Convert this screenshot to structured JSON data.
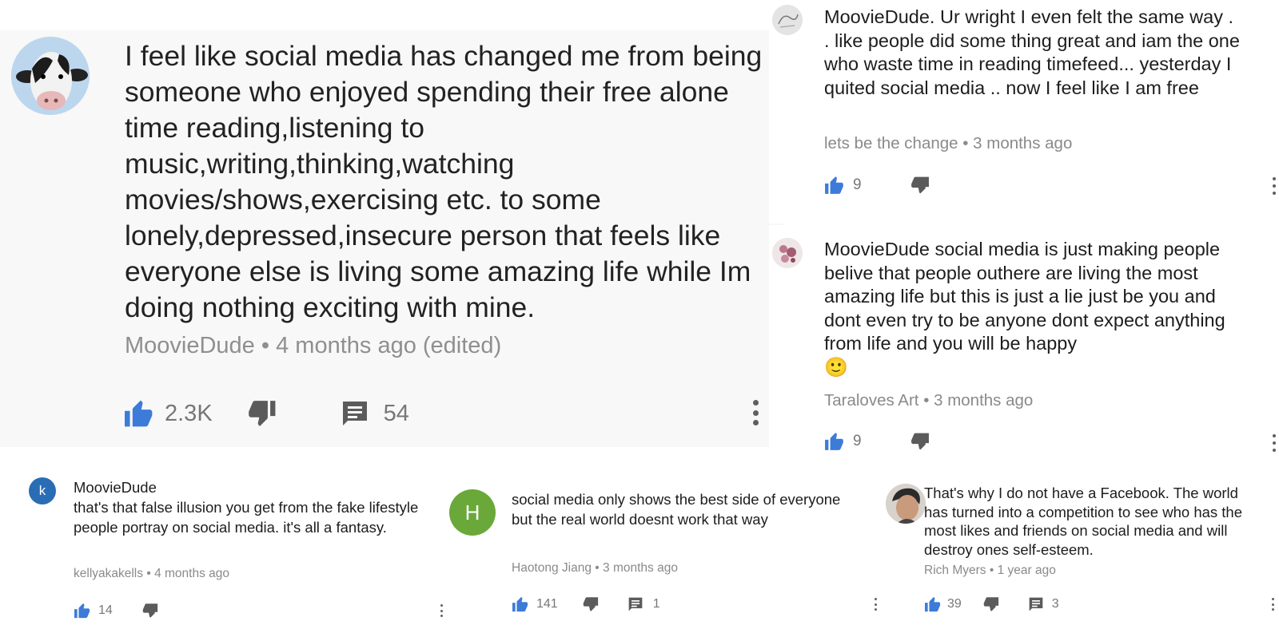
{
  "main": {
    "avatar_icon": "cow-avatar",
    "text": "I feel like social media has changed me from being someone who enjoyed spending their free alone time reading,listening to music,writing,thinking,watching movies/shows,exercising etc. to some lonely,depressed,insecure person that feels like everyone else is living some amazing life while Im doing nothing exciting with mine.",
    "author": "MoovieDude",
    "sep": "•",
    "time": "4 months ago (edited)",
    "likes": "2.3K",
    "replies": "54"
  },
  "reply1": {
    "text": "MoovieDude. Ur wright I even felt the same way . . like people did some thing great and iam the one who waste time in reading timefeed... yesterday I quited social media .. now I feel like I am free",
    "author": "lets be the change",
    "sep": "•",
    "time": "3 months ago",
    "likes": "9"
  },
  "reply2": {
    "text": "MoovieDude social  media  is just making people belive that people outhere are living the most amazing life but this is just a lie just be you and dont even try to be anyone  dont expect anything from life and you will be happy",
    "emoji": "🙂",
    "author": "Taraloves Art",
    "sep": "•",
    "time": "3 months ago",
    "likes": "9"
  },
  "c1": {
    "avatar_letter": "k",
    "author": "MoovieDude",
    "text": "that's that false illusion you get from the fake lifestyle people portray on social media. it's all a fantasy.",
    "meta_author": "kellyakakells",
    "sep": "•",
    "time": "4 months ago",
    "likes": "14"
  },
  "c2": {
    "avatar_letter": "H",
    "text": "social media only shows the best side of everyone but the real world doesnt work that way",
    "meta_author": "Haotong Jiang",
    "sep": "•",
    "time": "3 months ago",
    "likes": "141",
    "replies": "1"
  },
  "c3": {
    "text": "That's why I do not have a Facebook. The world has turned into a competition to see who has the most likes and friends on social media and will destroy ones self-esteem.",
    "meta_author": "Rich Myers",
    "sep": "•",
    "time": "1 year ago",
    "likes": "39",
    "replies": "3"
  },
  "colors": {
    "like_blue": "#3d7bd9",
    "dislike_gray": "#5b5b5b",
    "meta_gray": "#8a8a8a",
    "avatar_k": "#2a6db5",
    "avatar_h": "#6aa83a"
  }
}
